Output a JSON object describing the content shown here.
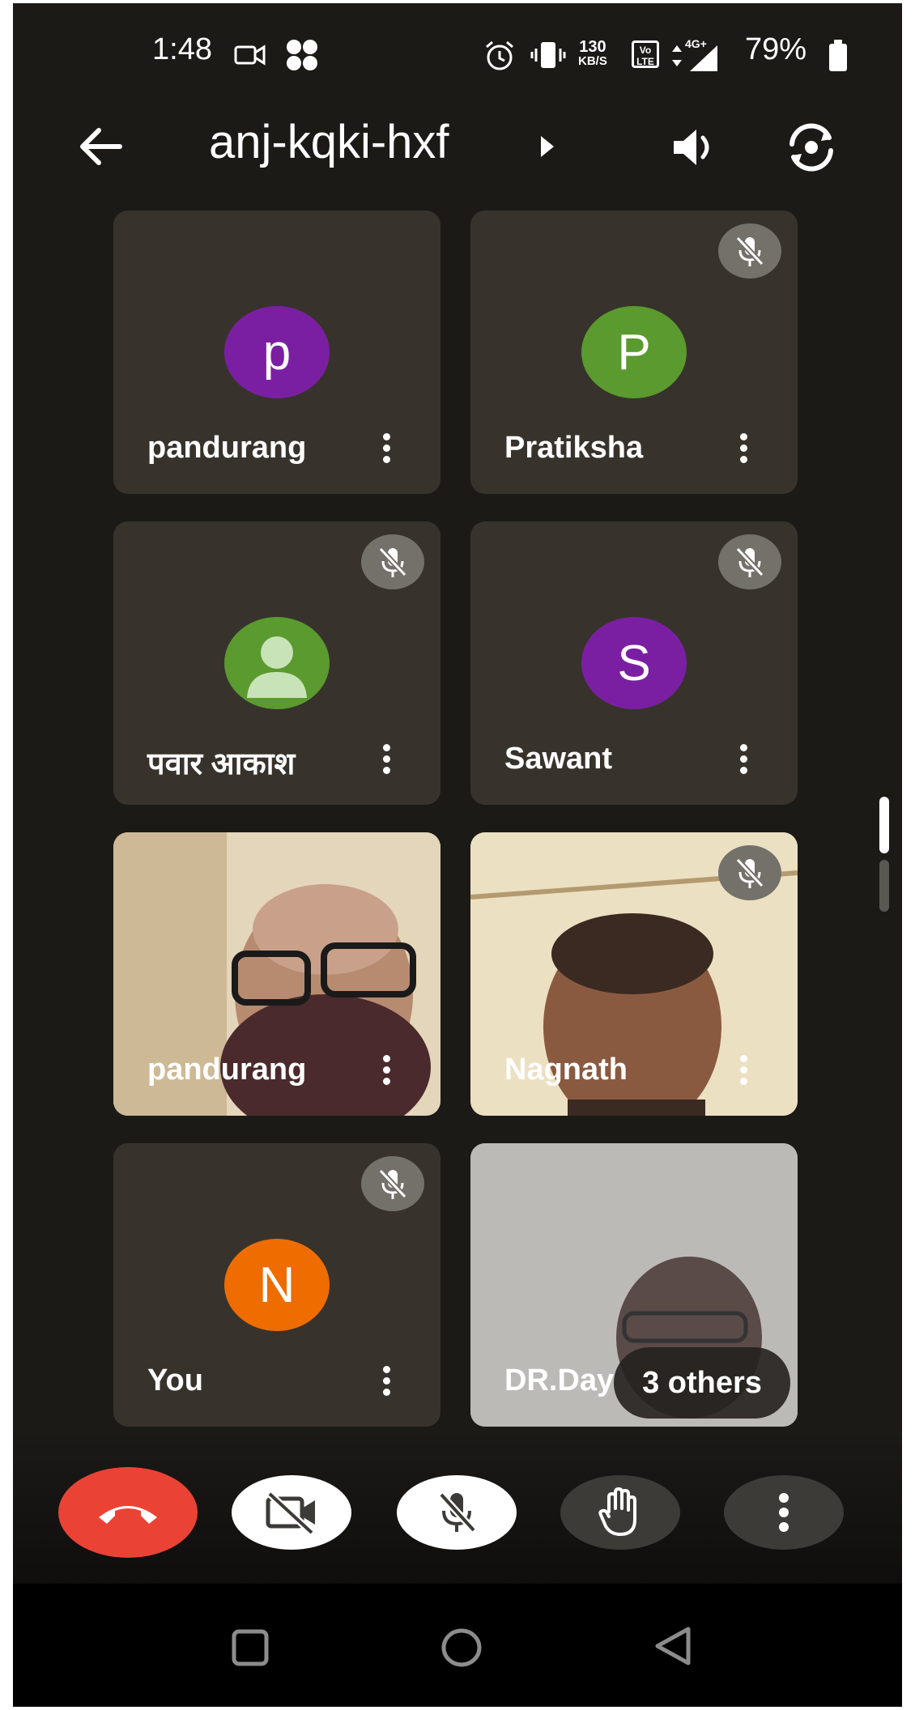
{
  "status_bar": {
    "time": "1:48",
    "speed_value": "130",
    "speed_unit": "KB/S",
    "volte": "Vo LTE",
    "network": "4G+",
    "battery_percent": "79%"
  },
  "header": {
    "meeting_code": "anj-kqki-hxf"
  },
  "tiles": [
    {
      "name": "pandurang",
      "initial": "p",
      "avatar_color": "#7b1fa2",
      "muted": false
    },
    {
      "name": "Pratiksha",
      "initial": "P",
      "avatar_color": "#5a9a2e",
      "muted": true
    },
    {
      "name": "पवार आकाश",
      "initial": "",
      "avatar_color": "#5a9a2e",
      "muted": true
    },
    {
      "name": "Sawant",
      "initial": "S",
      "avatar_color": "#7b1fa2",
      "muted": true
    },
    {
      "name": "pandurang",
      "initial": "",
      "muted": false
    },
    {
      "name": "Nagnath",
      "initial": "",
      "muted": true
    },
    {
      "name": "You",
      "initial": "N",
      "avatar_color": "#ef6c00",
      "muted": true
    },
    {
      "name": "DR.Day",
      "initial": "",
      "muted": false
    }
  ],
  "others_pill": "3 others",
  "colors": {
    "background": "#1b1a17",
    "tile": "#37332c",
    "end_call": "#ea4335",
    "control_light": "#ffffff",
    "control_dark": "#3c3b38"
  }
}
